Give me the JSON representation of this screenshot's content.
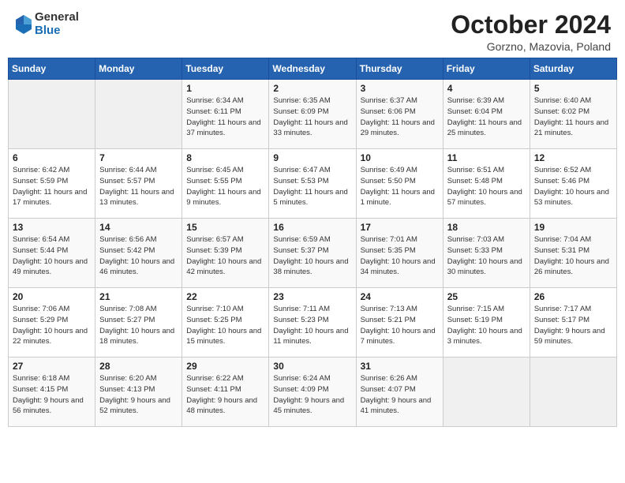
{
  "header": {
    "logo": {
      "general": "General",
      "blue": "Blue"
    },
    "title": "October 2024",
    "location": "Gorzno, Mazovia, Poland"
  },
  "days_of_week": [
    "Sunday",
    "Monday",
    "Tuesday",
    "Wednesday",
    "Thursday",
    "Friday",
    "Saturday"
  ],
  "weeks": [
    [
      {
        "day": "",
        "info": ""
      },
      {
        "day": "",
        "info": ""
      },
      {
        "day": "1",
        "info": "Sunrise: 6:34 AM\nSunset: 6:11 PM\nDaylight: 11 hours and 37 minutes."
      },
      {
        "day": "2",
        "info": "Sunrise: 6:35 AM\nSunset: 6:09 PM\nDaylight: 11 hours and 33 minutes."
      },
      {
        "day": "3",
        "info": "Sunrise: 6:37 AM\nSunset: 6:06 PM\nDaylight: 11 hours and 29 minutes."
      },
      {
        "day": "4",
        "info": "Sunrise: 6:39 AM\nSunset: 6:04 PM\nDaylight: 11 hours and 25 minutes."
      },
      {
        "day": "5",
        "info": "Sunrise: 6:40 AM\nSunset: 6:02 PM\nDaylight: 11 hours and 21 minutes."
      }
    ],
    [
      {
        "day": "6",
        "info": "Sunrise: 6:42 AM\nSunset: 5:59 PM\nDaylight: 11 hours and 17 minutes."
      },
      {
        "day": "7",
        "info": "Sunrise: 6:44 AM\nSunset: 5:57 PM\nDaylight: 11 hours and 13 minutes."
      },
      {
        "day": "8",
        "info": "Sunrise: 6:45 AM\nSunset: 5:55 PM\nDaylight: 11 hours and 9 minutes."
      },
      {
        "day": "9",
        "info": "Sunrise: 6:47 AM\nSunset: 5:53 PM\nDaylight: 11 hours and 5 minutes."
      },
      {
        "day": "10",
        "info": "Sunrise: 6:49 AM\nSunset: 5:50 PM\nDaylight: 11 hours and 1 minute."
      },
      {
        "day": "11",
        "info": "Sunrise: 6:51 AM\nSunset: 5:48 PM\nDaylight: 10 hours and 57 minutes."
      },
      {
        "day": "12",
        "info": "Sunrise: 6:52 AM\nSunset: 5:46 PM\nDaylight: 10 hours and 53 minutes."
      }
    ],
    [
      {
        "day": "13",
        "info": "Sunrise: 6:54 AM\nSunset: 5:44 PM\nDaylight: 10 hours and 49 minutes."
      },
      {
        "day": "14",
        "info": "Sunrise: 6:56 AM\nSunset: 5:42 PM\nDaylight: 10 hours and 46 minutes."
      },
      {
        "day": "15",
        "info": "Sunrise: 6:57 AM\nSunset: 5:39 PM\nDaylight: 10 hours and 42 minutes."
      },
      {
        "day": "16",
        "info": "Sunrise: 6:59 AM\nSunset: 5:37 PM\nDaylight: 10 hours and 38 minutes."
      },
      {
        "day": "17",
        "info": "Sunrise: 7:01 AM\nSunset: 5:35 PM\nDaylight: 10 hours and 34 minutes."
      },
      {
        "day": "18",
        "info": "Sunrise: 7:03 AM\nSunset: 5:33 PM\nDaylight: 10 hours and 30 minutes."
      },
      {
        "day": "19",
        "info": "Sunrise: 7:04 AM\nSunset: 5:31 PM\nDaylight: 10 hours and 26 minutes."
      }
    ],
    [
      {
        "day": "20",
        "info": "Sunrise: 7:06 AM\nSunset: 5:29 PM\nDaylight: 10 hours and 22 minutes."
      },
      {
        "day": "21",
        "info": "Sunrise: 7:08 AM\nSunset: 5:27 PM\nDaylight: 10 hours and 18 minutes."
      },
      {
        "day": "22",
        "info": "Sunrise: 7:10 AM\nSunset: 5:25 PM\nDaylight: 10 hours and 15 minutes."
      },
      {
        "day": "23",
        "info": "Sunrise: 7:11 AM\nSunset: 5:23 PM\nDaylight: 10 hours and 11 minutes."
      },
      {
        "day": "24",
        "info": "Sunrise: 7:13 AM\nSunset: 5:21 PM\nDaylight: 10 hours and 7 minutes."
      },
      {
        "day": "25",
        "info": "Sunrise: 7:15 AM\nSunset: 5:19 PM\nDaylight: 10 hours and 3 minutes."
      },
      {
        "day": "26",
        "info": "Sunrise: 7:17 AM\nSunset: 5:17 PM\nDaylight: 9 hours and 59 minutes."
      }
    ],
    [
      {
        "day": "27",
        "info": "Sunrise: 6:18 AM\nSunset: 4:15 PM\nDaylight: 9 hours and 56 minutes."
      },
      {
        "day": "28",
        "info": "Sunrise: 6:20 AM\nSunset: 4:13 PM\nDaylight: 9 hours and 52 minutes."
      },
      {
        "day": "29",
        "info": "Sunrise: 6:22 AM\nSunset: 4:11 PM\nDaylight: 9 hours and 48 minutes."
      },
      {
        "day": "30",
        "info": "Sunrise: 6:24 AM\nSunset: 4:09 PM\nDaylight: 9 hours and 45 minutes."
      },
      {
        "day": "31",
        "info": "Sunrise: 6:26 AM\nSunset: 4:07 PM\nDaylight: 9 hours and 41 minutes."
      },
      {
        "day": "",
        "info": ""
      },
      {
        "day": "",
        "info": ""
      }
    ]
  ]
}
